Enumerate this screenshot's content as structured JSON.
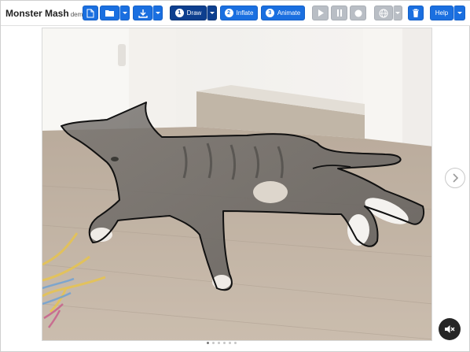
{
  "app": {
    "title": "Monster Mash",
    "subtitle": "demo"
  },
  "toolbar": {
    "draw_step": "1",
    "draw_label": "Draw",
    "inflate_step": "2",
    "inflate_label": "Inflate",
    "animate_step": "3",
    "animate_label": "Animate",
    "help_label": "Help",
    "icons": [
      "new-file-icon",
      "open-folder-icon",
      "download-icon",
      "play-icon",
      "pause-icon",
      "record-icon",
      "globe-icon",
      "trash-icon"
    ]
  },
  "colors": {
    "accent": "#1a6fe0",
    "active": "#0d3f8f",
    "disabled": "#b9bec5",
    "outline": "#111111"
  },
  "carousel": {
    "slide_count": 6,
    "active_slide": 1
  }
}
